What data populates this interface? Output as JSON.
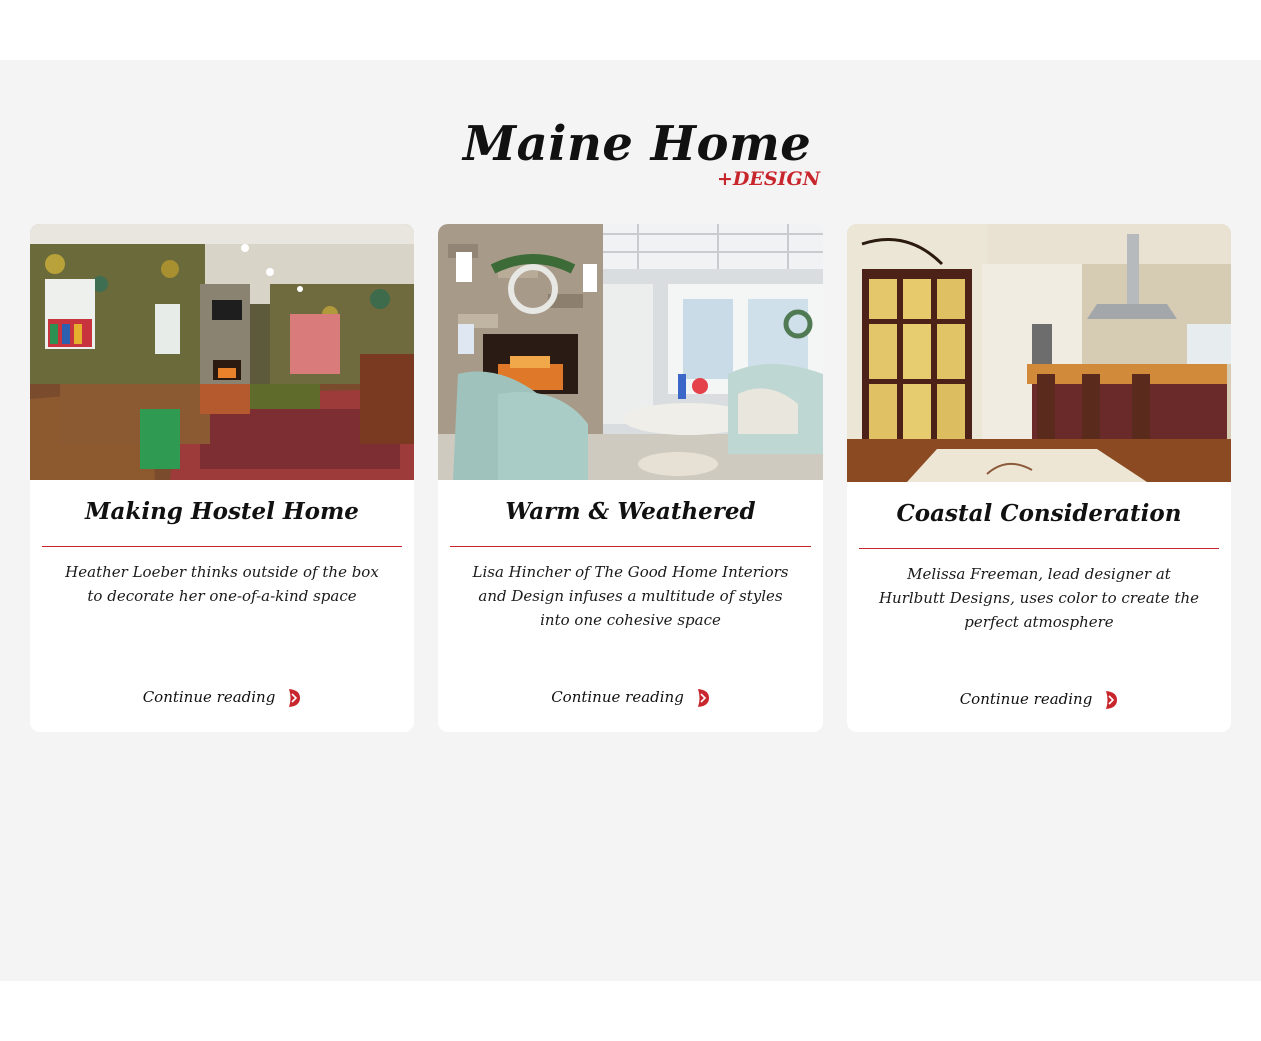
{
  "brand": {
    "name": "Maine Home",
    "suffix": "+DESIGN"
  },
  "colors": {
    "accent": "#c8262d",
    "section_bg": "#f4f4f4",
    "card_bg": "#ffffff",
    "text": "#111111"
  },
  "cards": [
    {
      "title": "Making Hostel Home",
      "description": "Heather Loeber thinks outside of the box to decorate her one-of-a-kind space",
      "link_label": "Continue reading",
      "link_icon": "chevron-right-icon"
    },
    {
      "title": "Warm & Weathered",
      "description": "Lisa Hincher of The Good Home Interiors and Design infuses a multitude of styles into one cohesive space",
      "link_label": "Continue reading",
      "link_icon": "chevron-right-icon"
    },
    {
      "title": "Coastal Consideration",
      "description": "Melissa Freeman, lead designer at Hurlbutt Designs, uses color to create the perfect atmosphere",
      "link_label": "Continue reading",
      "link_icon": "chevron-right-icon"
    }
  ]
}
